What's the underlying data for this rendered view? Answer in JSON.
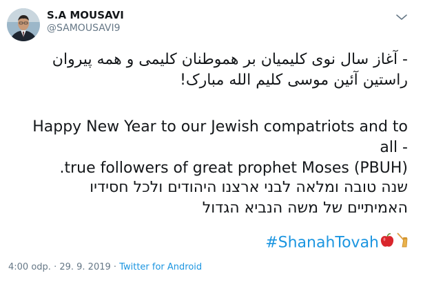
{
  "author": {
    "display_name": "S.A MOUSAVI",
    "handle": "@SAMOUSAVI9"
  },
  "menu_icon": "chevron-down-icon",
  "tweet": {
    "persian_line1": "- آغاز سال نوی کلیمیان بر هموطنان کلیمی و همه پیروان",
    "persian_line2": "راستین آئین موسی کلیم الله مبارک!",
    "english_line1": "Happy New Year to our Jewish compatriots and to all -",
    "english_line2": ".true followers of great prophet Moses (PBUH)",
    "hebrew_line1": "שנה טובה ומלאה לבני ארצנו היהודים ולכל חסידיו",
    "hebrew_line2": "האמיתיים של משה הנביא הגדול",
    "hashtag": "#ShanahTovah",
    "emojis": [
      "apple-icon",
      "honey-pot-icon"
    ]
  },
  "meta": {
    "time": "4:00 odp.",
    "separator": "·",
    "date": "29. 9. 2019",
    "source": "Twitter for Android"
  },
  "colors": {
    "link": "#1b95e0",
    "secondary_text": "#657786",
    "primary_text": "#14171a"
  }
}
